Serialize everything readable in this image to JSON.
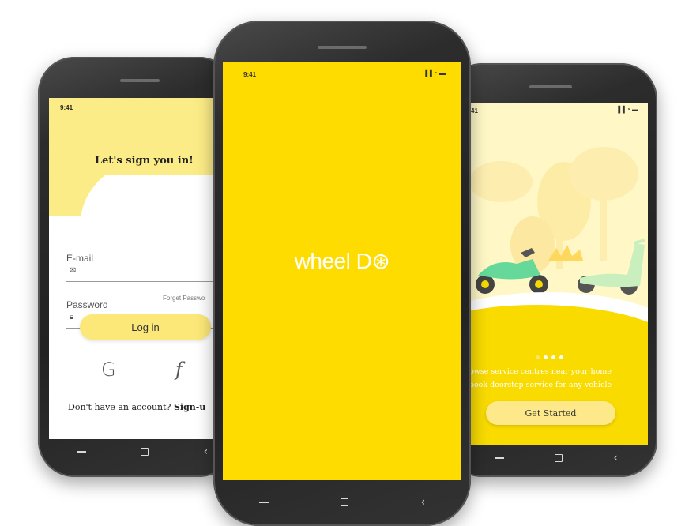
{
  "left_screen": {
    "time": "9:41",
    "heading": "Let's sign you in!",
    "email_label": "E-mail",
    "password_label": "Password",
    "forgot_label": "Forget Passwo",
    "login_label": "Log in",
    "google_icon": "G",
    "facebook_icon": "f",
    "signup_prefix": "Don't have an account? ",
    "signup_link": "Sign-u"
  },
  "center_screen": {
    "time": "9:41",
    "status": "▐▐ ◔ ▬",
    "brand": "wheel D⊛"
  },
  "right_screen": {
    "time": "41",
    "status": "▐▐ ◔ ▬",
    "desc_line1": "owse service centres near your home",
    "desc_line2": "book doorstep service for any vehicle",
    "cta_label": "Get Started"
  },
  "nav": {
    "back_glyph": "‹"
  },
  "colors": {
    "brand_yellow": "#ffdc00",
    "light_yellow": "#fcec87",
    "pale_yellow": "#fff8c6"
  }
}
